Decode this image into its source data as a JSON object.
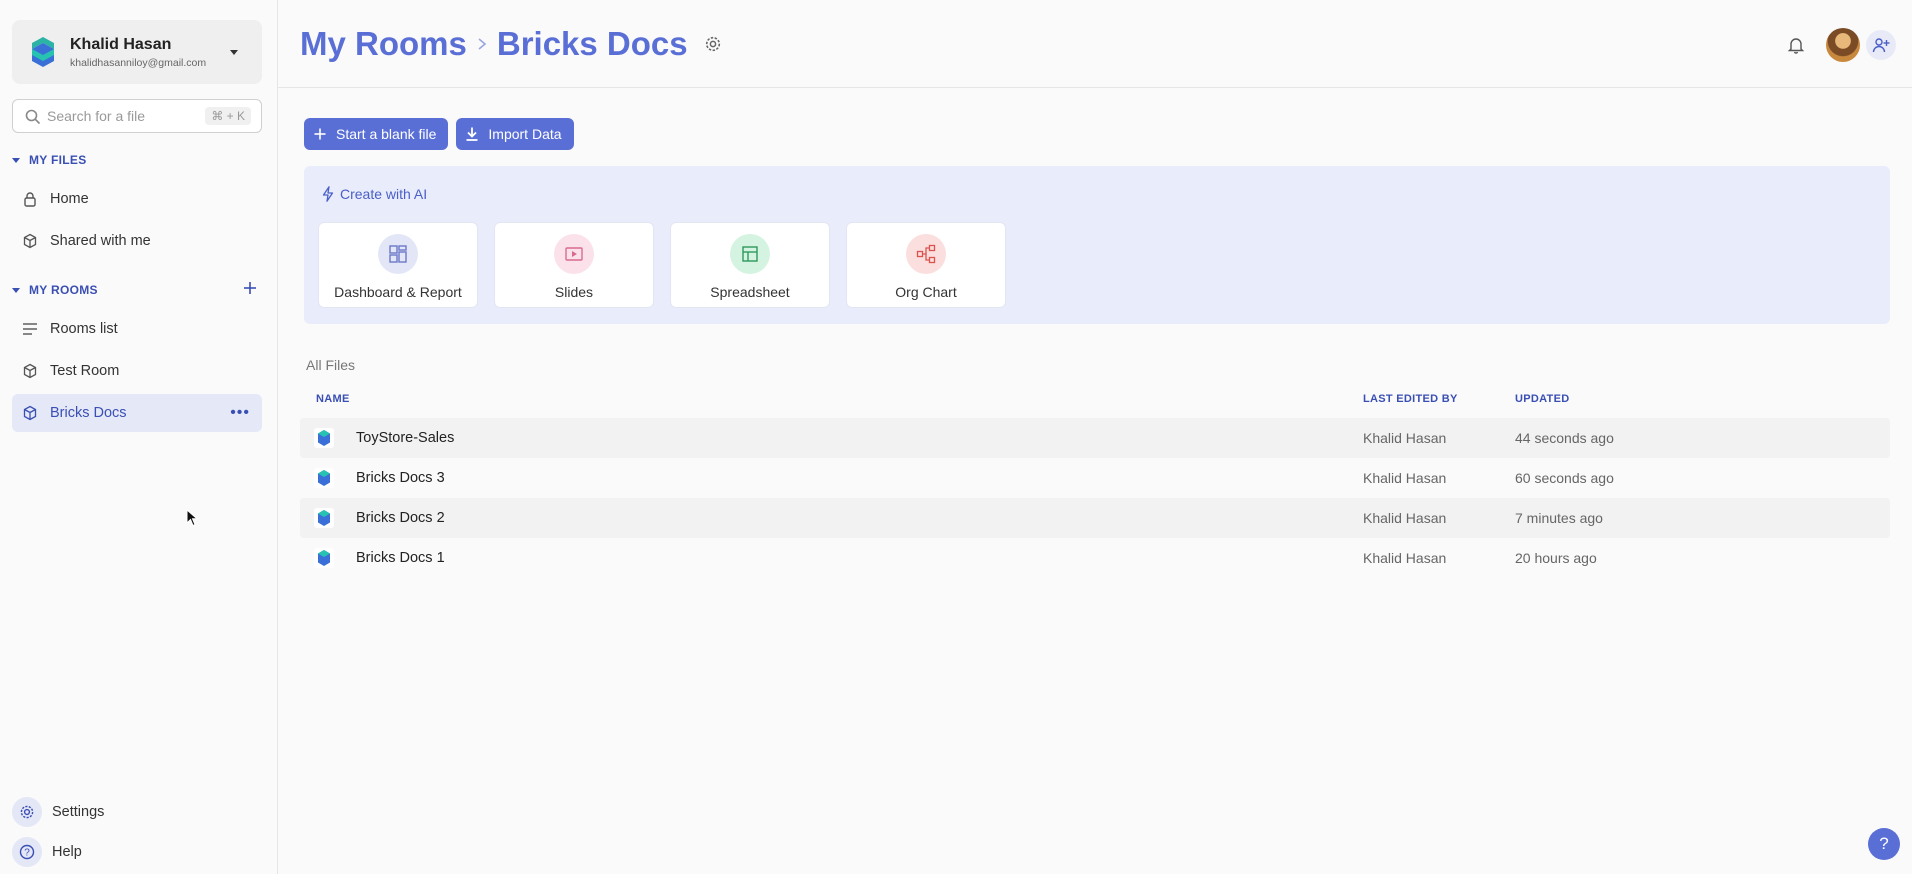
{
  "account": {
    "name": "Khalid Hasan",
    "email": "khalidhasanniloy@gmail.com"
  },
  "search": {
    "placeholder": "Search for a file",
    "shortcut": "⌘ + K"
  },
  "sidebar": {
    "my_files_label": "MY FILES",
    "my_files": [
      {
        "label": "Home",
        "icon": "lock-icon"
      },
      {
        "label": "Shared with me",
        "icon": "cube-icon"
      }
    ],
    "my_rooms_label": "MY ROOMS",
    "rooms": [
      {
        "label": "Rooms list",
        "icon": "list-icon"
      },
      {
        "label": "Test Room",
        "icon": "cube-icon"
      },
      {
        "label": "Bricks Docs",
        "icon": "cube-icon",
        "active": true
      }
    ],
    "settings_label": "Settings",
    "help_label": "Help"
  },
  "header": {
    "breadcrumb": [
      "My Rooms",
      "Bricks Docs"
    ]
  },
  "actions": {
    "blank_label": "Start a blank file",
    "import_label": "Import Data"
  },
  "ai": {
    "title": "Create with AI",
    "cards": [
      {
        "label": "Dashboard & Report",
        "icon": "dashboard-icon",
        "color": "#e3e6f7"
      },
      {
        "label": "Slides",
        "icon": "slides-icon",
        "color": "#fbe2ea"
      },
      {
        "label": "Spreadsheet",
        "icon": "spreadsheet-icon",
        "color": "#d5f3e1"
      },
      {
        "label": "Org Chart",
        "icon": "org-chart-icon",
        "color": "#fbdede"
      }
    ]
  },
  "files": {
    "section_label": "All Files",
    "columns": {
      "name": "NAME",
      "editor": "LAST EDITED BY",
      "updated": "UPDATED"
    },
    "rows": [
      {
        "name": "ToyStore-Sales",
        "editor": "Khalid Hasan",
        "updated": "44 seconds ago"
      },
      {
        "name": "Bricks Docs 3",
        "editor": "Khalid Hasan",
        "updated": "60 seconds ago"
      },
      {
        "name": "Bricks Docs 2",
        "editor": "Khalid Hasan",
        "updated": "7 minutes ago"
      },
      {
        "name": "Bricks Docs 1",
        "editor": "Khalid Hasan",
        "updated": "20 hours ago"
      }
    ]
  },
  "help_fab": "?",
  "colors": {
    "accent": "#5a6fd6",
    "accent_dark": "#3a4fb4",
    "panel": "#e9ecfb"
  }
}
